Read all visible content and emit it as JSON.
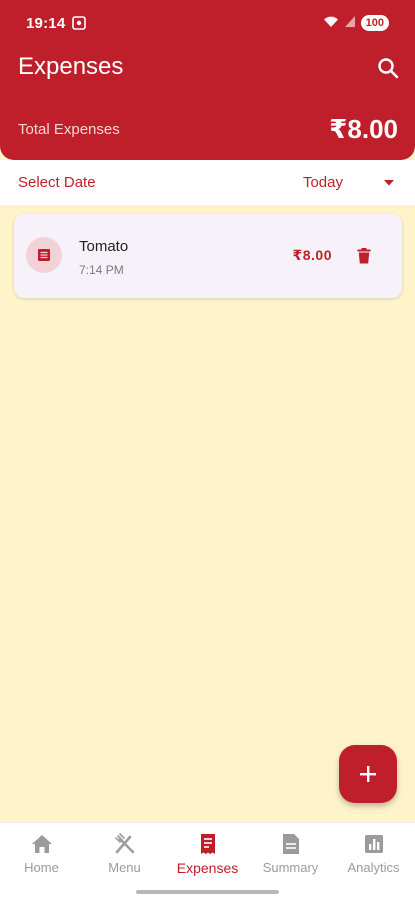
{
  "status_bar": {
    "time": "19:14",
    "battery": "100"
  },
  "header": {
    "title": "Expenses",
    "total_label": "Total Expenses",
    "total_value": "₹8.00"
  },
  "date_filter": {
    "label": "Select Date",
    "selected": "Today"
  },
  "expenses": [
    {
      "name": "Tomato",
      "time": "7:14 PM",
      "amount": "₹8.00"
    }
  ],
  "bottom_nav": {
    "items": [
      {
        "label": "Home",
        "icon": "home-icon"
      },
      {
        "label": "Menu",
        "icon": "restaurant-icon"
      },
      {
        "label": "Expenses",
        "icon": "receipt-icon",
        "active": true
      },
      {
        "label": "Summary",
        "icon": "document-icon"
      },
      {
        "label": "Analytics",
        "icon": "bar-chart-icon"
      }
    ]
  },
  "colors": {
    "primary": "#bf1f2a",
    "background": "#fef3c9",
    "card": "#f7f2fa",
    "inactive": "#9b9b9b"
  }
}
